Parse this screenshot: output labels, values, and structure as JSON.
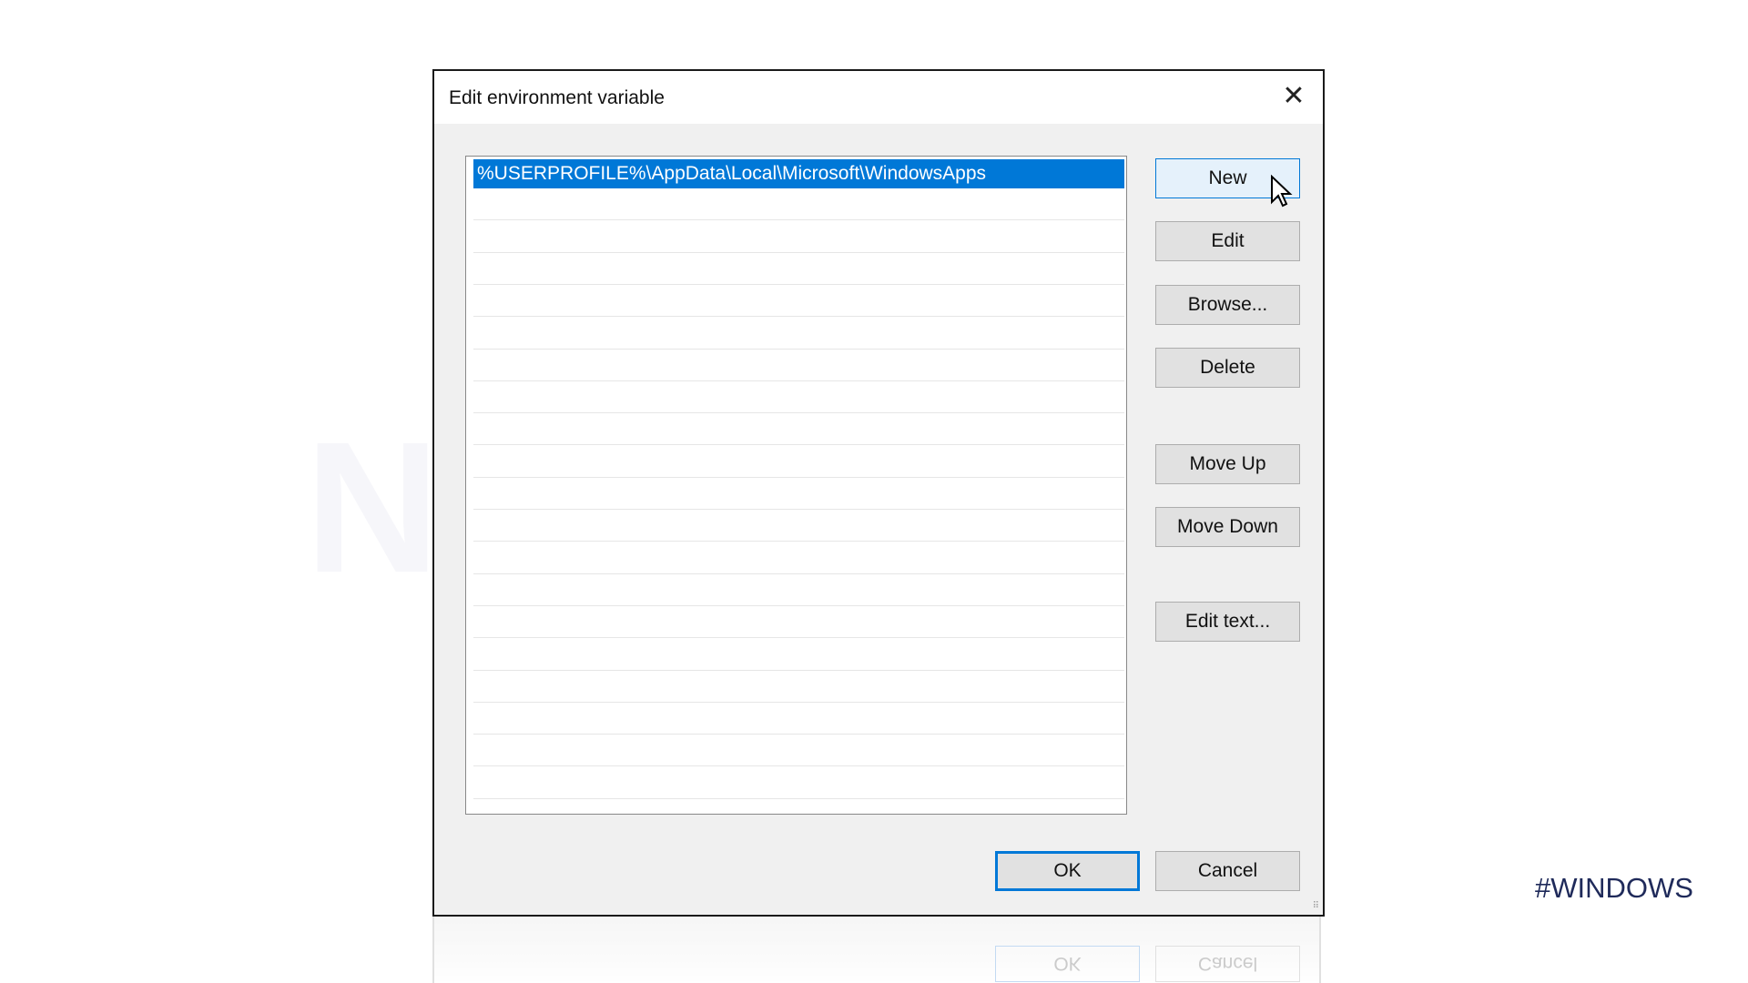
{
  "dialog": {
    "title": "Edit environment variable",
    "close_icon": "close-icon"
  },
  "list": {
    "items": [
      "%USERPROFILE%\\AppData\\Local\\Microsoft\\WindowsApps"
    ],
    "selected_index": 0,
    "selection_color": "#0078d7"
  },
  "buttons": {
    "new": "New",
    "edit": "Edit",
    "browse": "Browse...",
    "delete": "Delete",
    "move_up": "Move Up",
    "move_down": "Move Down",
    "edit_text": "Edit text...",
    "ok": "OK",
    "cancel": "Cancel"
  },
  "watermark": "NeuronVM",
  "tag": "#WINDOWS"
}
